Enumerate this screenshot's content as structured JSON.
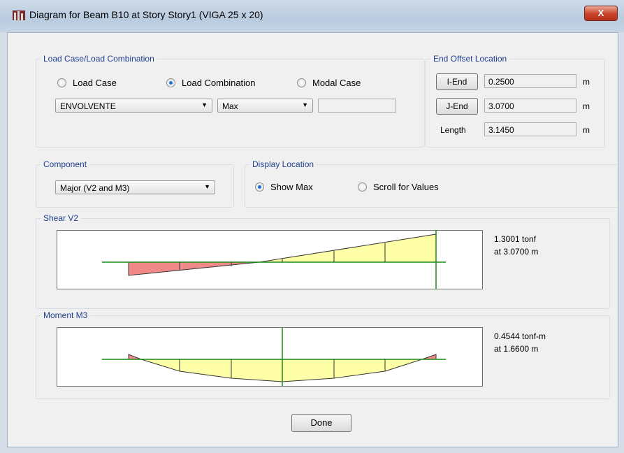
{
  "window": {
    "title": "Diagram for Beam B10 at Story Story1 (VIGA 25 x 20)",
    "close_label": "X"
  },
  "load_group": {
    "legend": "Load Case/Load Combination",
    "options": [
      "Load Case",
      "Load Combination",
      "Modal Case"
    ],
    "selected": "Load Combination",
    "combo_value": "ENVOLVENTE",
    "type_value": "Max",
    "extra_value": ""
  },
  "end_offset": {
    "legend": "End Offset Location",
    "i_end_label": "I-End",
    "i_end_value": "0.2500",
    "j_end_label": "J-End",
    "j_end_value": "3.0700",
    "length_label": "Length",
    "length_value": "3.1450",
    "unit": "m"
  },
  "component": {
    "legend": "Component",
    "value": "Major (V2 and M3)"
  },
  "display_location": {
    "legend": "Display Location",
    "options": [
      "Show Max",
      "Scroll for Values"
    ],
    "selected": "Show Max"
  },
  "shear": {
    "legend": "Shear V2",
    "max_value": "1.3001 tonf",
    "max_location": "at 3.0700 m"
  },
  "moment": {
    "legend": "Moment M3",
    "max_value": "0.4544 tonf-m",
    "max_location": "at 1.6600 m"
  },
  "done_label": "Done",
  "colors": {
    "diagram_fill": "#ffffa8",
    "negative_fill": "#f08a88",
    "cursor": "#1a8a1a",
    "legend_text": "#1f3f8f"
  }
}
